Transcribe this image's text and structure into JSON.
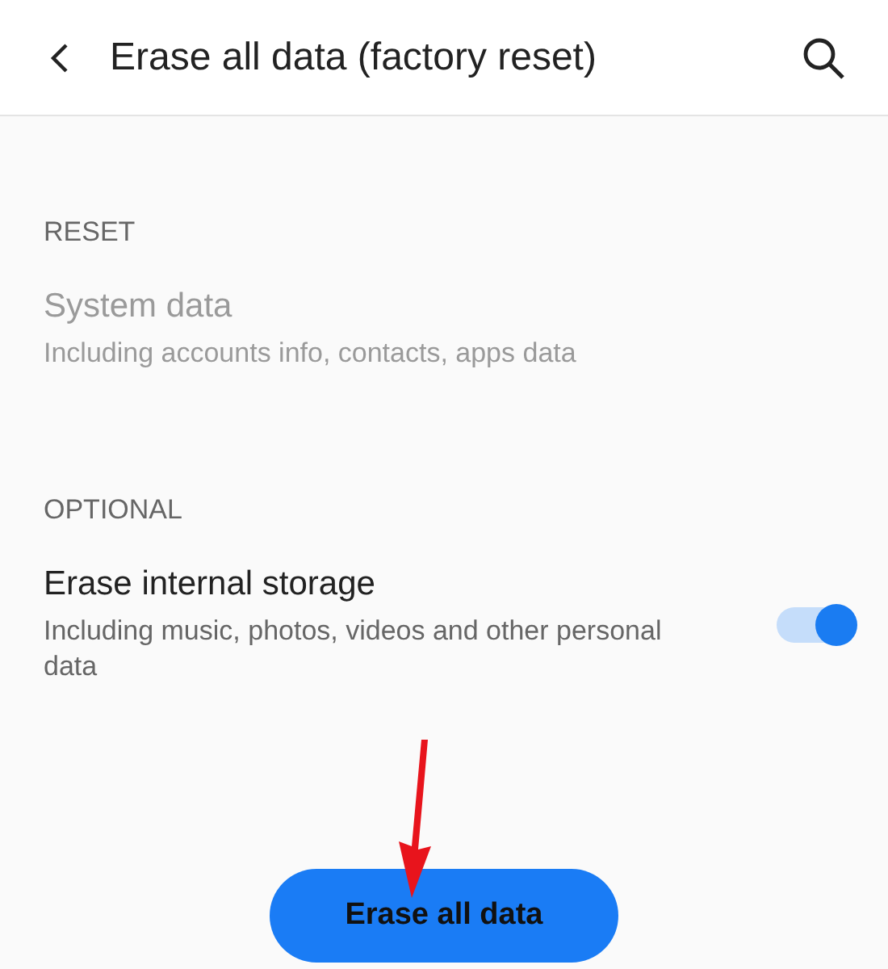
{
  "header": {
    "title": "Erase all data (factory reset)"
  },
  "sections": [
    {
      "heading": "RESET",
      "items": [
        {
          "kind": "text",
          "title": "System data",
          "subtitle": "Including accounts info, contacts, apps data",
          "disabled": true
        }
      ]
    },
    {
      "heading": "OPTIONAL",
      "items": [
        {
          "kind": "toggle",
          "title": "Erase internal storage",
          "subtitle": "Including music, photos, videos and other personal data",
          "disabled": false,
          "on": true
        }
      ]
    }
  ],
  "button": {
    "label": "Erase all data"
  }
}
